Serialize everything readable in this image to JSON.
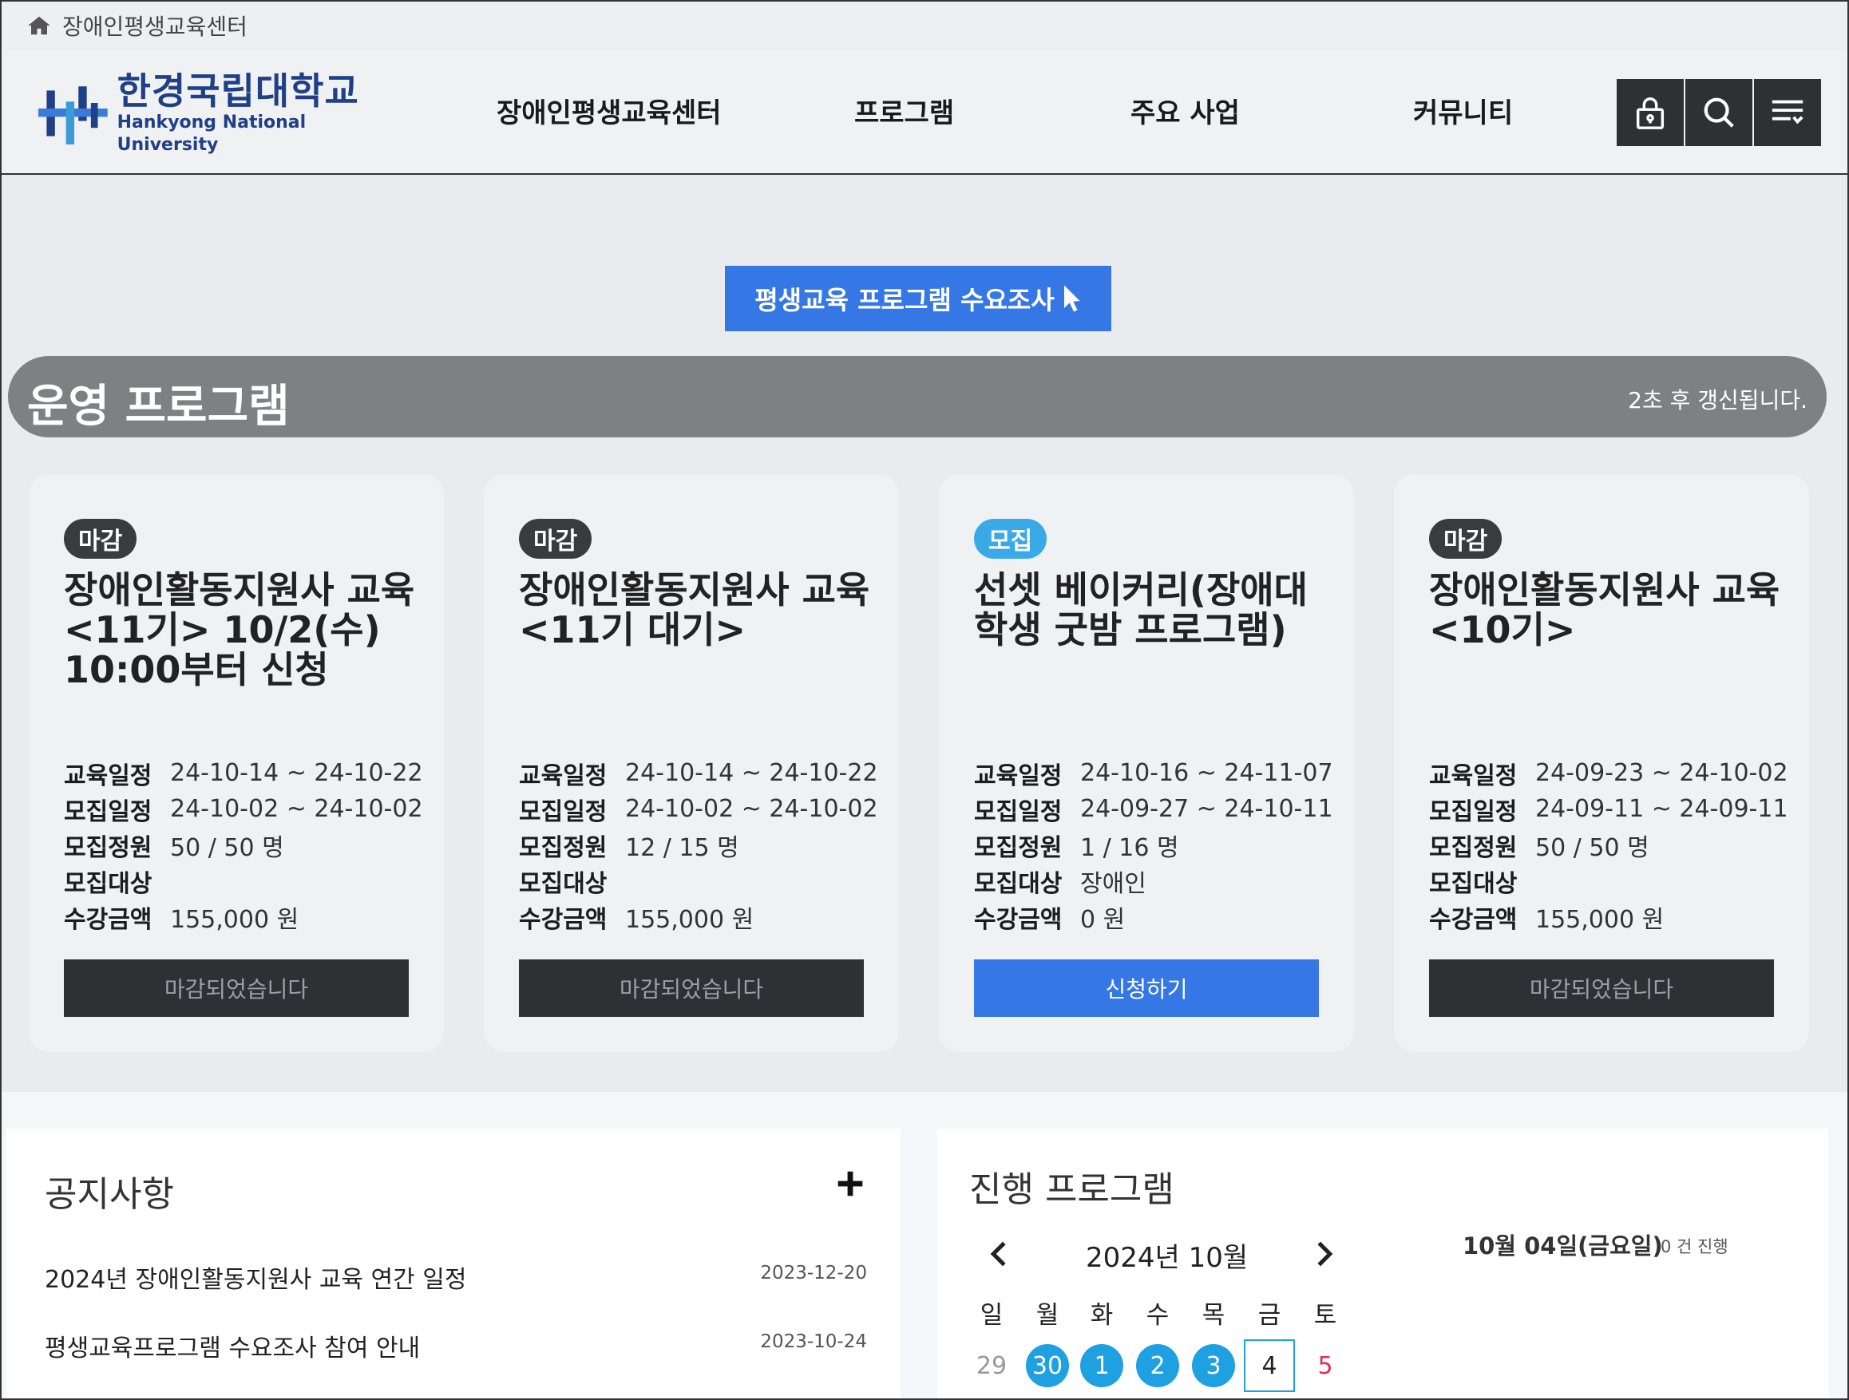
{
  "topbar": {
    "title": "장애인평생교육센터",
    "icon": "home-icon"
  },
  "header": {
    "logo": {
      "ko": "한경국립대학교",
      "en": "Hankyong National University"
    },
    "nav": [
      "장애인평생교육센터",
      "프로그램",
      "주요 사업",
      "커뮤니티"
    ],
    "buttons": [
      "lock-icon",
      "search-icon",
      "menu-icon"
    ]
  },
  "survey_button": "평생교육 프로그램 수요조사",
  "section": {
    "title": "운영 프로그램",
    "refresh_text": "2초 후 갱신됩니다."
  },
  "labels": {
    "edu_period": "교육일정",
    "recruit_period": "모집일정",
    "capacity": "모집정원",
    "target": "모집대상",
    "fee": "수강금액"
  },
  "cards": [
    {
      "status": "마감",
      "title": "장애인활동지원사 교육 <11기> 10/2(수) 10:00부터 신청",
      "edu_period": "24-10-14 ~ 24-10-22",
      "recruit_period": "24-10-02 ~ 24-10-02",
      "capacity": "50 / 50 명",
      "target": "",
      "fee": "155,000 원",
      "button": "마감되었습니다"
    },
    {
      "status": "마감",
      "title": "장애인활동지원사 교육 <11기 대기>",
      "edu_period": "24-10-14 ~ 24-10-22",
      "recruit_period": "24-10-02 ~ 24-10-02",
      "capacity": "12 / 15 명",
      "target": "",
      "fee": "155,000 원",
      "button": "마감되었습니다"
    },
    {
      "status": "모집",
      "title": "선셋 베이커리(장애대학생 굿밤 프로그램)",
      "edu_period": "24-10-16 ~ 24-11-07",
      "recruit_period": "24-09-27 ~ 24-10-11",
      "capacity": "1 / 16 명",
      "target": "장애인",
      "fee": "0 원",
      "button": "신청하기"
    },
    {
      "status": "마감",
      "title": "장애인활동지원사 교육 <10기>",
      "edu_period": "24-09-23 ~ 24-10-02",
      "recruit_period": "24-09-11 ~ 24-09-11",
      "capacity": "50 / 50 명",
      "target": "",
      "fee": "155,000 원",
      "button": "마감되었습니다"
    }
  ],
  "notice": {
    "title": "공지사항",
    "items": [
      {
        "text": "2024년 장애인활동지원사 교육 연간 일정",
        "date": "2023-12-20"
      },
      {
        "text": "평생교육프로그램 수요조사 참여 안내",
        "date": "2023-10-24"
      }
    ]
  },
  "program_calendar": {
    "title": "진행 프로그램",
    "month": "2024년 10월",
    "weekdays": [
      "일",
      "월",
      "화",
      "수",
      "목",
      "금",
      "토"
    ],
    "days": [
      "29",
      "30",
      "1",
      "2",
      "3",
      "4",
      "5"
    ],
    "selected_date": "10월 04일(금요일)",
    "selected_count": "0 건 진행"
  },
  "colors": {
    "accent_blue": "#3578e5",
    "badge_open": "#3aa9e8",
    "badge_closed": "#3a3b3e",
    "calendar_past": "#1fa0e0",
    "saturday": "#e0315a"
  }
}
